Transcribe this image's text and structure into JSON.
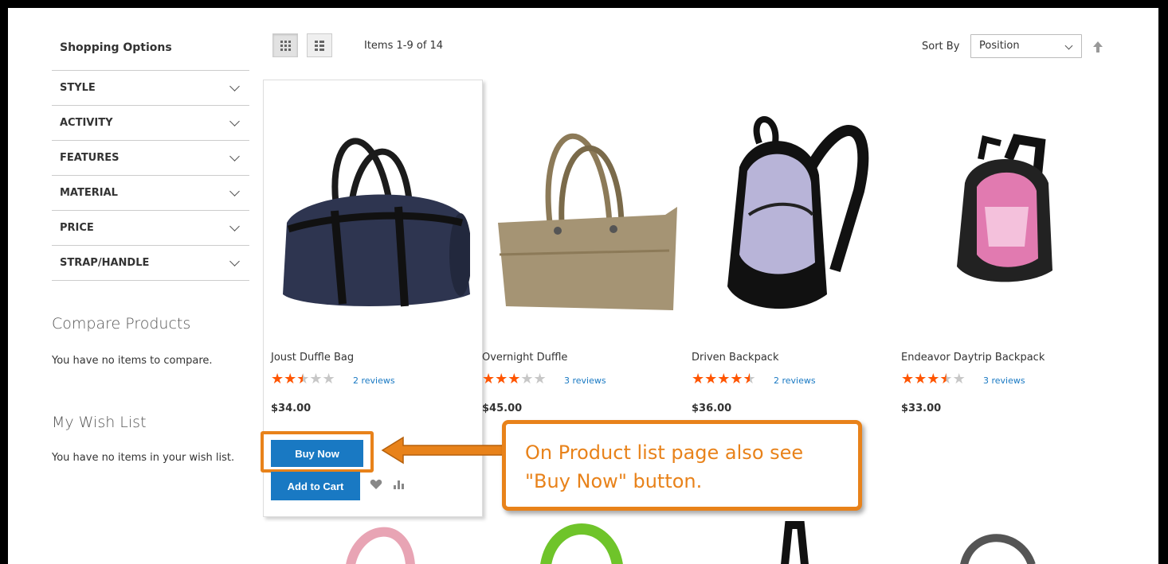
{
  "sidebar": {
    "title": "Shopping Options",
    "filters": [
      "STYLE",
      "ACTIVITY",
      "FEATURES",
      "MATERIAL",
      "PRICE",
      "STRAP/HANDLE"
    ],
    "compare": {
      "title": "Compare Products",
      "text": "You have no items to compare."
    },
    "wishlist": {
      "title": "My Wish List",
      "text": "You have no items in your wish list."
    }
  },
  "toolbar": {
    "items_count": "Items 1-9 of 14",
    "sort_label": "Sort By",
    "sort_value": "Position",
    "view_modes": [
      "grid-icon",
      "list-icon"
    ]
  },
  "products": [
    {
      "name": "Joust Duffle Bag",
      "rating": 2.5,
      "reviews": "2 reviews",
      "price": "$34.00"
    },
    {
      "name": "Overnight Duffle",
      "rating": 3,
      "reviews": "3 reviews",
      "price": "$45.00"
    },
    {
      "name": "Driven Backpack",
      "rating": 4.5,
      "reviews": "2 reviews",
      "price": "$36.00"
    },
    {
      "name": "Endeavor Daytrip Backpack",
      "rating": 3.5,
      "reviews": "3 reviews",
      "price": "$33.00"
    }
  ],
  "actions": {
    "buy_now": "Buy Now",
    "add_to_cart": "Add to Cart"
  },
  "callout": {
    "line1": "On Product list page also see",
    "line2": "\"Buy Now\" button."
  },
  "colors": {
    "accent_blue": "#1979c3",
    "annotation_orange": "#e8821a",
    "star_orange": "#ff5501"
  }
}
